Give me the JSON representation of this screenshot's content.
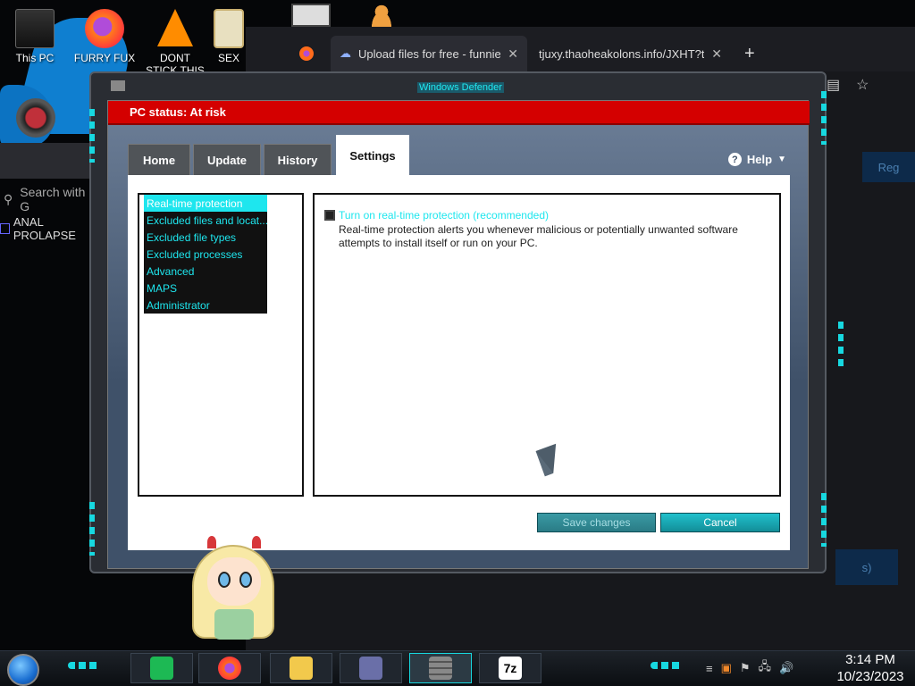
{
  "desktop": {
    "icons": [
      {
        "label": "This PC"
      },
      {
        "label": "FURRY FUX"
      },
      {
        "label": "DONT STICK THIS IN YO"
      },
      {
        "label": "SEX"
      }
    ]
  },
  "browser": {
    "tabs": [
      {
        "label": "Upload files for free - funnies.zi"
      },
      {
        "label": "tjuxy.thaoheakolons.info/JXHT?tag..."
      }
    ],
    "new_tab_label": "+",
    "tab_close": "✕",
    "search_placeholder": "Search with G",
    "result_text": "ANAL PROLAPSE",
    "reg_text": "Reg",
    "s_text": "s)"
  },
  "frame": {
    "title": "Windows Defender"
  },
  "defender": {
    "status": "PC status: At risk",
    "tabs": [
      {
        "label": "Home"
      },
      {
        "label": "Update"
      },
      {
        "label": "History"
      },
      {
        "label": "Settings"
      }
    ],
    "help_label": "Help",
    "help_icon": "?",
    "sidebar": [
      {
        "label": "Real-time protection"
      },
      {
        "label": "Excluded files and locat..."
      },
      {
        "label": "Excluded file types"
      },
      {
        "label": "Excluded processes"
      },
      {
        "label": "Advanced"
      },
      {
        "label": "MAPS"
      },
      {
        "label": "Administrator"
      }
    ],
    "realtime_label": "Turn on real-time protection (recommended)",
    "realtime_desc": "Real-time protection alerts you whenever malicious or potentially unwanted software attempts to install itself or run on your PC.",
    "save_label": "Save changes",
    "cancel_label": "Cancel"
  },
  "taskbar": {
    "time": "3:14 PM",
    "date": "10/23/2023",
    "apps": [
      "spotify-icon",
      "firefox-icon",
      "file-explorer-icon",
      "control-panel-icon",
      "firewall-icon",
      "7zip-icon"
    ],
    "sevenzip_label": "7z"
  },
  "colors": {
    "accent": "#1ee6ee",
    "status_red": "#d40000"
  }
}
